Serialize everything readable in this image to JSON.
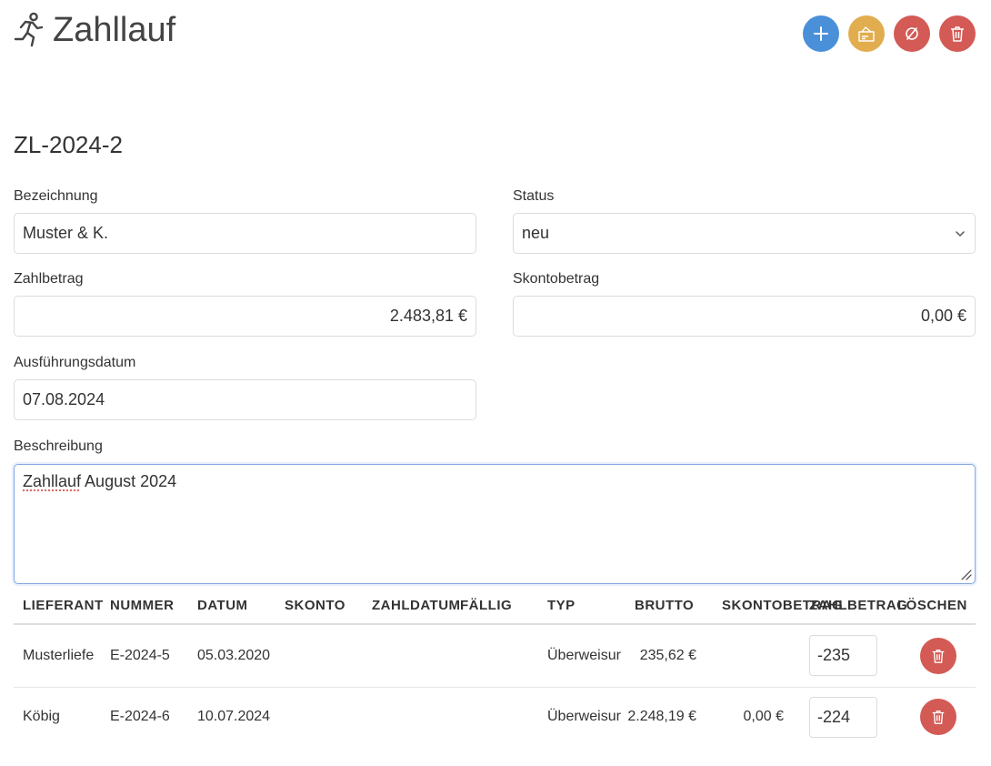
{
  "page": {
    "title": "Zahllauf",
    "record_id": "ZL-2024-2"
  },
  "colors": {
    "add": "#4a90d9",
    "export": "#e1ad4f",
    "cancel": "#d35a55",
    "delete": "#d35a55"
  },
  "form": {
    "bezeichnung": {
      "label": "Bezeichnung",
      "value": "Muster & K."
    },
    "status": {
      "label": "Status",
      "value": "neu"
    },
    "zahlbetrag": {
      "label": "Zahlbetrag",
      "value": "2.483,81 €"
    },
    "skontobetrag": {
      "label": "Skontobetrag",
      "value": "0,00 €"
    },
    "ausfuehrungsdatum": {
      "label": "Ausführungsdatum",
      "value": "07.08.2024"
    },
    "beschreibung": {
      "label": "Beschreibung",
      "value_word1": "Zahllauf",
      "value_rest": " August 2024"
    }
  },
  "table": {
    "headers": [
      "LIEFERANT",
      "NUMMER",
      "DATUM",
      "SKONTO",
      "ZAHLDATUM",
      "FÄLLIG",
      "TYP",
      "BRUTTO",
      "SKONTOBETRAG",
      "ZAHLBETRAG",
      "LÖSCHEN"
    ],
    "rows": [
      {
        "lieferant": "Musterliefe",
        "nummer": "E-2024-5",
        "datum": "05.03.2020",
        "skonto": "",
        "zahldatum": "",
        "faellig": "",
        "typ": "Überweisur",
        "brutto": "235,62 €",
        "skontobetrag": "",
        "zahlbetrag": "-235"
      },
      {
        "lieferant": "Köbig",
        "nummer": "E-2024-6",
        "datum": "10.07.2024",
        "skonto": "",
        "zahldatum": "",
        "faellig": "",
        "typ": "Überweisur",
        "brutto": "2.248,19 €",
        "skontobetrag": "0,00 €",
        "zahlbetrag": "-224"
      }
    ]
  }
}
